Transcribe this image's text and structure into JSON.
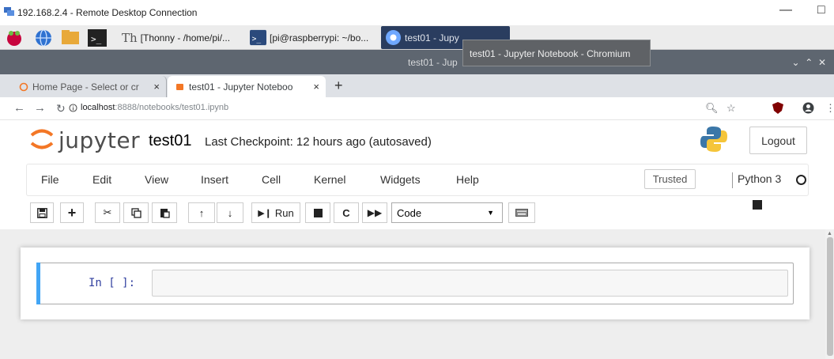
{
  "rdp": {
    "title": "192.168.2.4 - Remote Desktop Connection",
    "minimize": "—",
    "maximize": "□"
  },
  "taskbar": {
    "thonny_label": "[Thonny  -  /home/pi/...",
    "terminal_label": "[pi@raspberrypi: ~/bo...",
    "chrome_label": "test01 - Jupy"
  },
  "chromium": {
    "window_title": "test01 - Jup",
    "tooltip": "test01 - Jupyter Notebook - Chromium",
    "tabs": [
      {
        "label": "Home Page - Select or cr",
        "close": "×"
      },
      {
        "label": "test01 - Jupyter Noteboo",
        "close": "×"
      }
    ],
    "new_tab": "+",
    "url_host": "localhost",
    "url_path": ":8888/notebooks/test01.ipynb"
  },
  "jupyter": {
    "brand": "jupyter",
    "notebook_name": "test01",
    "checkpoint": "Last Checkpoint: 12 hours ago  (autosaved)",
    "logout": "Logout",
    "menus": [
      "File",
      "Edit",
      "View",
      "Insert",
      "Cell",
      "Kernel",
      "Widgets",
      "Help"
    ],
    "trusted": "Trusted",
    "kernel_name": "Python 3",
    "run_label": "Run",
    "cell_type": "Code",
    "prompt": "In [ ]:"
  },
  "colors": {
    "accent": "#42a5f5",
    "jupyter_orange": "#f37726",
    "taskbar_active": "#2a3d5f"
  }
}
